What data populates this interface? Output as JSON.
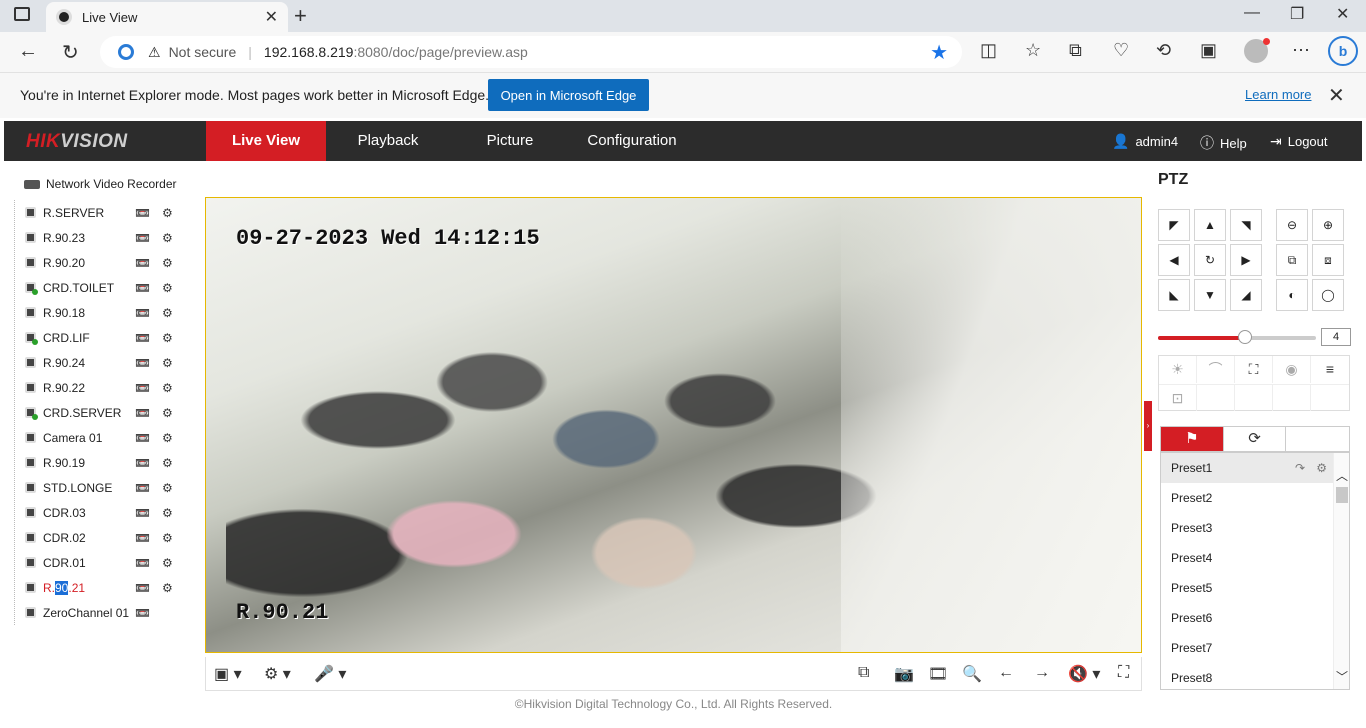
{
  "browser": {
    "tab_title": "Live View",
    "not_secure": "Not secure",
    "url_host": "192.168.8.219",
    "url_rest": ":8080/doc/page/preview.asp",
    "ie_message": "You're in Internet Explorer mode. Most pages work better in Microsoft Edge.",
    "open_edge_label": "Open in Microsoft Edge",
    "learn_more": "Learn more"
  },
  "app": {
    "logo_main": "HIK",
    "logo_rest": "VISION",
    "nav": [
      {
        "label": "Live View"
      },
      {
        "label": "Playback"
      },
      {
        "label": "Picture"
      },
      {
        "label": "Configuration"
      }
    ],
    "user": "admin4",
    "help": "Help",
    "logout": "Logout"
  },
  "sidebar": {
    "root": "Network Video Recorder",
    "cameras": [
      {
        "name": "R.SERVER"
      },
      {
        "name": "R.90.23"
      },
      {
        "name": "R.90.20"
      },
      {
        "name": "CRD.TOILET"
      },
      {
        "name": "R.90.18"
      },
      {
        "name": "CRD.LIF"
      },
      {
        "name": "R.90.24"
      },
      {
        "name": "R.90.22"
      },
      {
        "name": "CRD.SERVER"
      },
      {
        "name": "Camera 01"
      },
      {
        "name": "R.90.19"
      },
      {
        "name": "STD.LONGE"
      },
      {
        "name": "CDR.03"
      },
      {
        "name": "CDR.02"
      },
      {
        "name": "CDR.01"
      },
      {
        "name_pre": "R.",
        "name_sel": "90",
        "name_post": ".21"
      },
      {
        "name": "ZeroChannel 01"
      }
    ]
  },
  "video": {
    "osd_time": "09-27-2023 Wed 14:12:15",
    "osd_name": "R.90.21"
  },
  "footer": "©Hikvision Digital Technology Co., Ltd. All Rights Reserved.",
  "ptz": {
    "title": "PTZ",
    "speed": "4",
    "speed_level": 0.55,
    "presets": [
      "Preset1",
      "Preset2",
      "Preset3",
      "Preset4",
      "Preset5",
      "Preset6",
      "Preset7",
      "Preset8"
    ]
  },
  "colors": {
    "brand_red": "#d41e24",
    "nav_bg": "#2c2c2c",
    "edge_blue": "#0f6cbd"
  }
}
